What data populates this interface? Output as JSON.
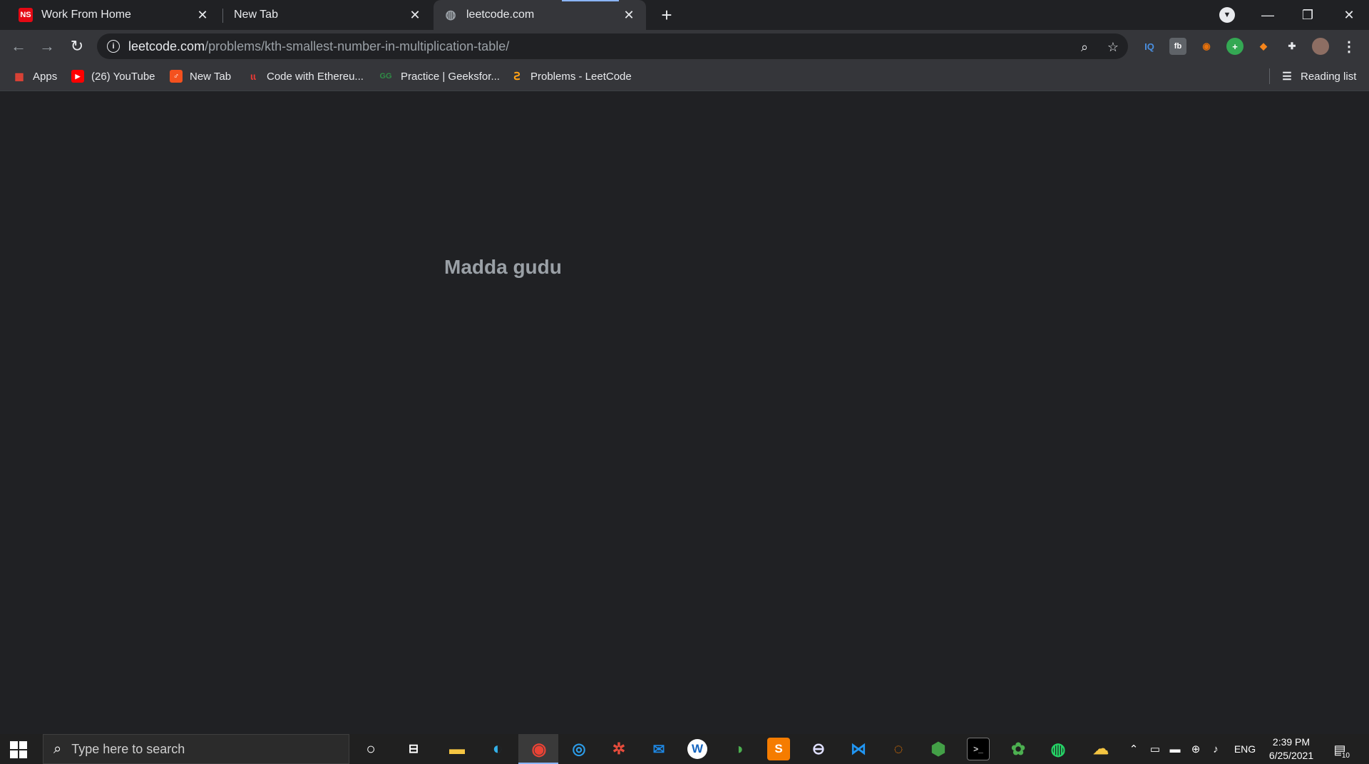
{
  "tabs": [
    {
      "title": "Work From Home",
      "favicon": "NS",
      "favicon_color": "#e50914"
    },
    {
      "title": "New Tab",
      "favicon": "",
      "favicon_color": ""
    },
    {
      "title": "leetcode.com",
      "favicon": "globe-icon",
      "favicon_color": "#9aa0a6"
    }
  ],
  "address_bar": {
    "host": "leetcode.com",
    "path": "/problems/kth-smallest-number-in-multiplication-table/"
  },
  "bookmarks": [
    {
      "label": "Apps"
    },
    {
      "label": "(26) YouTube"
    },
    {
      "label": "New Tab"
    },
    {
      "label": "Code with Ethereu..."
    },
    {
      "label": "Practice | Geeksfor..."
    },
    {
      "label": "Problems - LeetCode"
    }
  ],
  "reading_list": "Reading list",
  "page": {
    "message": "Madda gudu"
  },
  "taskbar": {
    "search_placeholder": "Type here to search",
    "language": "ENG",
    "time": "2:39 PM",
    "date": "6/25/2021",
    "notification_count": "10"
  },
  "colors": {
    "page_background": "#202124",
    "toolbar": "#35363a",
    "accent": "#8ab4f8"
  }
}
